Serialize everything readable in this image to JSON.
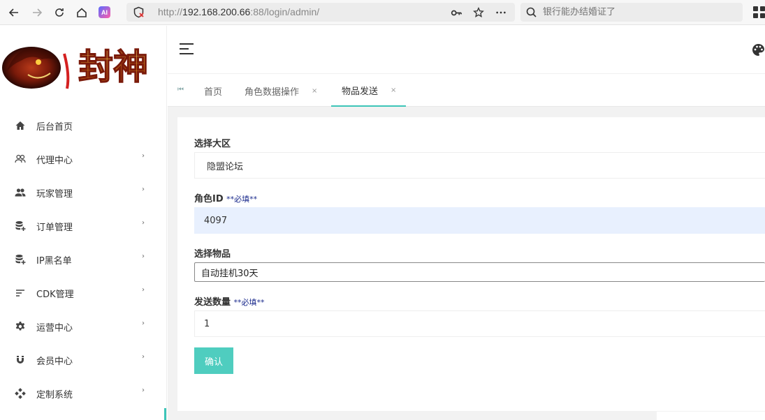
{
  "browser": {
    "url_prefix": "http://",
    "url_host": "192.168.200.66",
    "url_rest": ":88/login/admin/",
    "search_placeholder": "银行能办结婚证了",
    "ai_badge": "AI"
  },
  "logo": {
    "text": "封神"
  },
  "sidebar": {
    "items": [
      {
        "label": "后台首页",
        "icon": "home-icon",
        "arrow": false
      },
      {
        "label": "代理中心",
        "icon": "users-outline-icon",
        "arrow": true
      },
      {
        "label": "玩家管理",
        "icon": "users-icon",
        "arrow": true
      },
      {
        "label": "订单管理",
        "icon": "database-add-icon",
        "arrow": true
      },
      {
        "label": "IP黑名单",
        "icon": "database-add-icon",
        "arrow": true
      },
      {
        "label": "CDK管理",
        "icon": "sort-lines-icon",
        "arrow": true
      },
      {
        "label": "运营中心",
        "icon": "gear-icon",
        "arrow": true
      },
      {
        "label": "会员中心",
        "icon": "magnet-icon",
        "arrow": true
      },
      {
        "label": "定制系统",
        "icon": "diamond-dots-icon",
        "arrow": true
      }
    ],
    "arrow_glyph": "›"
  },
  "tabs": [
    {
      "label": "首页",
      "closable": false
    },
    {
      "label": "角色数据操作",
      "closable": true
    },
    {
      "label": "物品发送",
      "closable": true,
      "active": true
    }
  ],
  "tab_close_glyph": "×",
  "form": {
    "region": {
      "label": "选择大区",
      "value": "隐盟论坛"
    },
    "role_id": {
      "label": "角色ID",
      "required": "**必填**",
      "value": "4097"
    },
    "item": {
      "label": "选择物品",
      "value": "自动挂机30天"
    },
    "quantity": {
      "label": "发送数量",
      "required": "**必填**",
      "value": "1"
    },
    "confirm_label": "确认"
  },
  "colors": {
    "accent": "#4fcdbf",
    "tab_active": "#3dc5b8",
    "required_text": "#1a2a8c"
  }
}
